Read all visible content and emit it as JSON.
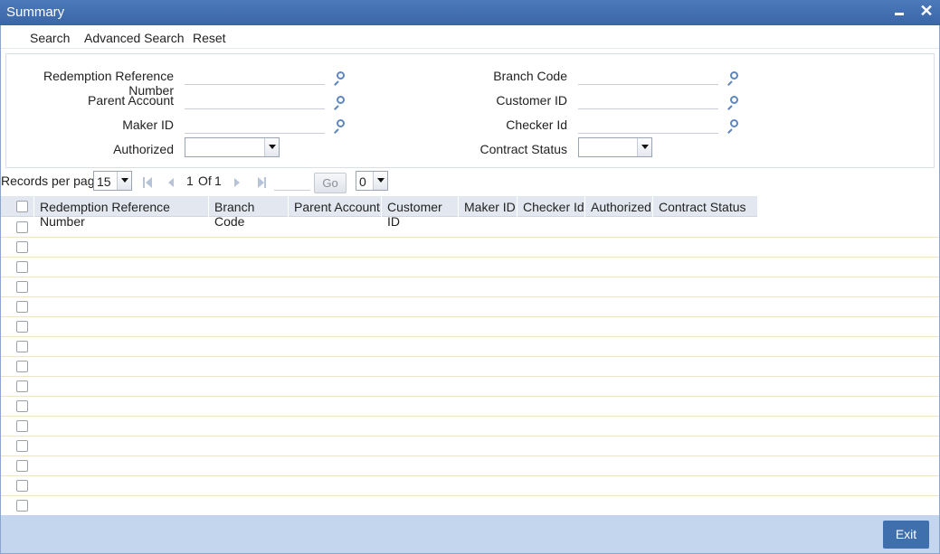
{
  "window": {
    "title": "Summary"
  },
  "toolbar": {
    "search": "Search",
    "advanced_search": "Advanced Search",
    "reset": "Reset"
  },
  "criteria": {
    "redemption_reference_number": "Redemption Reference Number",
    "parent_account": "Parent Account",
    "maker_id": "Maker ID",
    "authorized": "Authorized",
    "branch_code": "Branch Code",
    "customer_id": "Customer ID",
    "checker_id": "Checker Id",
    "contract_status": "Contract Status",
    "authorized_value": "",
    "contract_status_value": ""
  },
  "pager": {
    "records_per_page_label": "Records per page",
    "records_per_page_value": "15",
    "current_page": "1",
    "of_label": "Of",
    "total_pages": "1",
    "go_label": "Go",
    "extra_select_value": "0"
  },
  "grid": {
    "columns": [
      "Redemption Reference Number",
      "Branch Code",
      "Parent Account",
      "Customer ID",
      "Maker ID",
      "Checker Id",
      "Authorized",
      "Contract Status"
    ]
  },
  "footer": {
    "exit_label": "Exit"
  },
  "colors": {
    "titlebar": "#3a66a8",
    "footer": "#c3d6ee",
    "exit_button": "#3f70ad",
    "lookup_icon": "#5e86bf"
  }
}
